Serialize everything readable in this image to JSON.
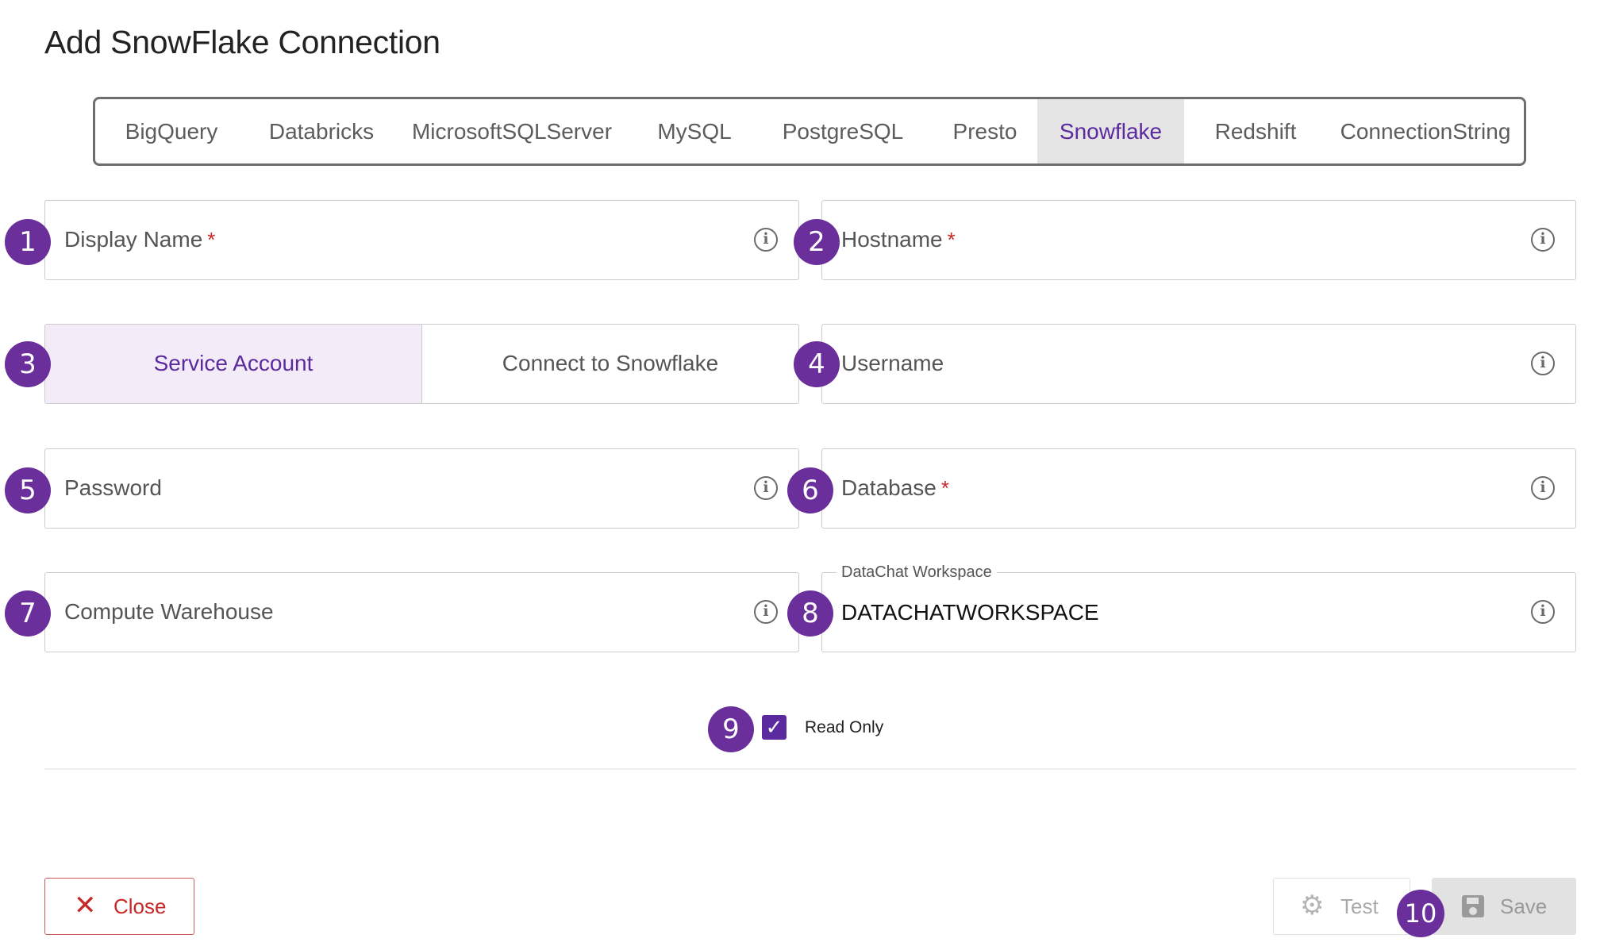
{
  "dialog": {
    "title": "Add SnowFlake Connection"
  },
  "tabs": [
    {
      "label": "BigQuery"
    },
    {
      "label": "Databricks"
    },
    {
      "label": "MicrosoftSQLServer"
    },
    {
      "label": "MySQL"
    },
    {
      "label": "PostgreSQL"
    },
    {
      "label": "Presto"
    },
    {
      "label": "Snowflake",
      "active": true
    },
    {
      "label": "Redshift"
    },
    {
      "label": "ConnectionString"
    }
  ],
  "fields": {
    "display_name": {
      "label": "Display Name",
      "required_mark": "*"
    },
    "hostname": {
      "label": "Hostname",
      "required_mark": "*"
    },
    "username": {
      "label": "Username"
    },
    "password": {
      "label": "Password"
    },
    "database": {
      "label": "Database",
      "required_mark": "*"
    },
    "compute_warehouse": {
      "label": "Compute Warehouse"
    },
    "workspace": {
      "label": "DataChat Workspace",
      "value": "DATACHATWORKSPACE"
    }
  },
  "auth_toggle": {
    "options": [
      "Service Account",
      "Connect to Snowflake"
    ],
    "selected": "Service Account"
  },
  "read_only": {
    "label": "Read Only",
    "checked": true
  },
  "buttons": {
    "close": "Close",
    "test": "Test",
    "save": "Save"
  },
  "markers": [
    "1",
    "2",
    "3",
    "4",
    "5",
    "6",
    "7",
    "8",
    "9",
    "10"
  ],
  "icons": {
    "info": "info-icon",
    "close": "close-icon",
    "test": "gear-icon",
    "save": "floppy-disk-icon",
    "checkbox": "check-icon"
  },
  "colors": {
    "accent": "#5b2a9e",
    "marker": "#6a2f9b",
    "danger": "#c62828",
    "tab_active_bg": "#e5e5e5"
  }
}
